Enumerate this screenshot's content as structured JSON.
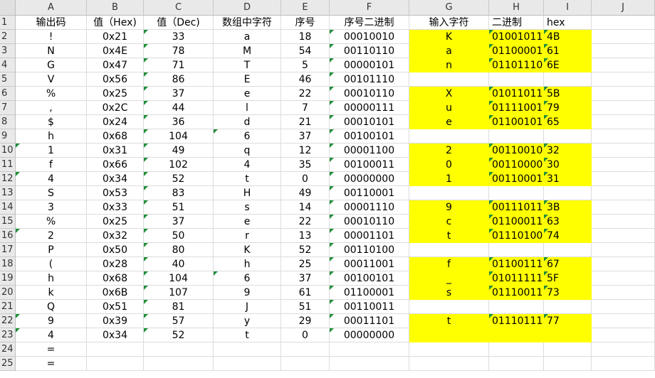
{
  "columns": [
    "A",
    "B",
    "C",
    "D",
    "E",
    "F",
    "G",
    "H",
    "I",
    "J"
  ],
  "rows": [
    {
      "A": "输出码",
      "B": "值（Hex)",
      "C": "值（Dec)",
      "D": "数组中字符",
      "E": "序号",
      "F": "序号二进制",
      "G": "输入字符",
      "H": "二进制",
      "I": "hex"
    },
    {
      "A": "!",
      "B": "0x21",
      "C": "33",
      "D": "a",
      "E": "18",
      "F": "00010010",
      "G": "K",
      "H": "01001011",
      "I": "4B"
    },
    {
      "A": "N",
      "B": "0x4E",
      "C": "78",
      "D": "M",
      "E": "54",
      "F": "00110110",
      "G": "a",
      "H": "01100001",
      "I": "61"
    },
    {
      "A": "G",
      "B": "0x47",
      "C": "71",
      "D": "T",
      "E": "5",
      "F": "00000101",
      "G": "n",
      "H": "01101110",
      "I": "6E"
    },
    {
      "A": "V",
      "B": "0x56",
      "C": "86",
      "D": "E",
      "E": "46",
      "F": "00101110",
      "G": "",
      "H": "",
      "I": ""
    },
    {
      "A": "%",
      "B": "0x25",
      "C": "37",
      "D": "e",
      "E": "22",
      "F": "00010110",
      "G": "X",
      "H": "01011011",
      "I": "5B"
    },
    {
      "A": ",",
      "B": "0x2C",
      "C": "44",
      "D": "l",
      "E": "7",
      "F": "00000111",
      "G": "u",
      "H": "01111001",
      "I": "79"
    },
    {
      "A": "$",
      "B": "0x24",
      "C": "36",
      "D": "d",
      "E": "21",
      "F": "00010101",
      "G": "e",
      "H": "01100101",
      "I": "65"
    },
    {
      "A": "h",
      "B": "0x68",
      "C": "104",
      "D": "6",
      "E": "37",
      "F": "00100101",
      "G": "",
      "H": "",
      "I": ""
    },
    {
      "A": "1",
      "B": "0x31",
      "C": "49",
      "D": "q",
      "E": "12",
      "F": "00001100",
      "G": "2",
      "H": "00110010",
      "I": "32"
    },
    {
      "A": "f",
      "B": "0x66",
      "C": "102",
      "D": "4",
      "E": "35",
      "F": "00100011",
      "G": "0",
      "H": "00110000",
      "I": "30"
    },
    {
      "A": "4",
      "B": "0x34",
      "C": "52",
      "D": "t",
      "E": "0",
      "F": "00000000",
      "G": "1",
      "H": "00110001",
      "I": "31"
    },
    {
      "A": "S",
      "B": "0x53",
      "C": "83",
      "D": "H",
      "E": "49",
      "F": "00110001",
      "G": "",
      "H": "",
      "I": ""
    },
    {
      "A": "3",
      "B": "0x33",
      "C": "51",
      "D": "s",
      "E": "14",
      "F": "00001110",
      "G": "9",
      "H": "00111011",
      "I": "3B"
    },
    {
      "A": "%",
      "B": "0x25",
      "C": "37",
      "D": "e",
      "E": "22",
      "F": "00010110",
      "G": "c",
      "H": "01100011",
      "I": "63"
    },
    {
      "A": "2",
      "B": "0x32",
      "C": "50",
      "D": "r",
      "E": "13",
      "F": "00001101",
      "G": "t",
      "H": "01110100",
      "I": "74"
    },
    {
      "A": "P",
      "B": "0x50",
      "C": "80",
      "D": "K",
      "E": "52",
      "F": "00110100",
      "G": "",
      "H": "",
      "I": ""
    },
    {
      "A": "(",
      "B": "0x28",
      "C": "40",
      "D": "h",
      "E": "25",
      "F": "00011001",
      "G": "f",
      "H": "01100111",
      "I": "67"
    },
    {
      "A": "h",
      "B": "0x68",
      "C": "104",
      "D": "6",
      "E": "37",
      "F": "00100101",
      "G": "_",
      "H": "01011111",
      "I": "5F"
    },
    {
      "A": "k",
      "B": "0x6B",
      "C": "107",
      "D": "9",
      "E": "61",
      "F": "01100001",
      "G": "s",
      "H": "01110011",
      "I": "73"
    },
    {
      "A": "Q",
      "B": "0x51",
      "C": "81",
      "D": "J",
      "E": "51",
      "F": "00110011",
      "G": "",
      "H": "",
      "I": ""
    },
    {
      "A": "9",
      "B": "0x39",
      "C": "57",
      "D": "y",
      "E": "29",
      "F": "00011101",
      "G": "t",
      "H": "01110111",
      "I": "77"
    },
    {
      "A": "4",
      "B": "0x34",
      "C": "52",
      "D": "t",
      "E": "0",
      "F": "00000000",
      "G": "",
      "H": "",
      "I": ""
    },
    {
      "A": "=",
      "B": "",
      "C": "",
      "D": "",
      "E": "",
      "F": "",
      "G": "",
      "H": "",
      "I": ""
    },
    {
      "A": "=",
      "B": "",
      "C": "",
      "D": "",
      "E": "",
      "F": "",
      "G": "",
      "H": "",
      "I": ""
    }
  ],
  "highlight_color": "#FFFF00",
  "indicator_color": "#1F8F3A"
}
